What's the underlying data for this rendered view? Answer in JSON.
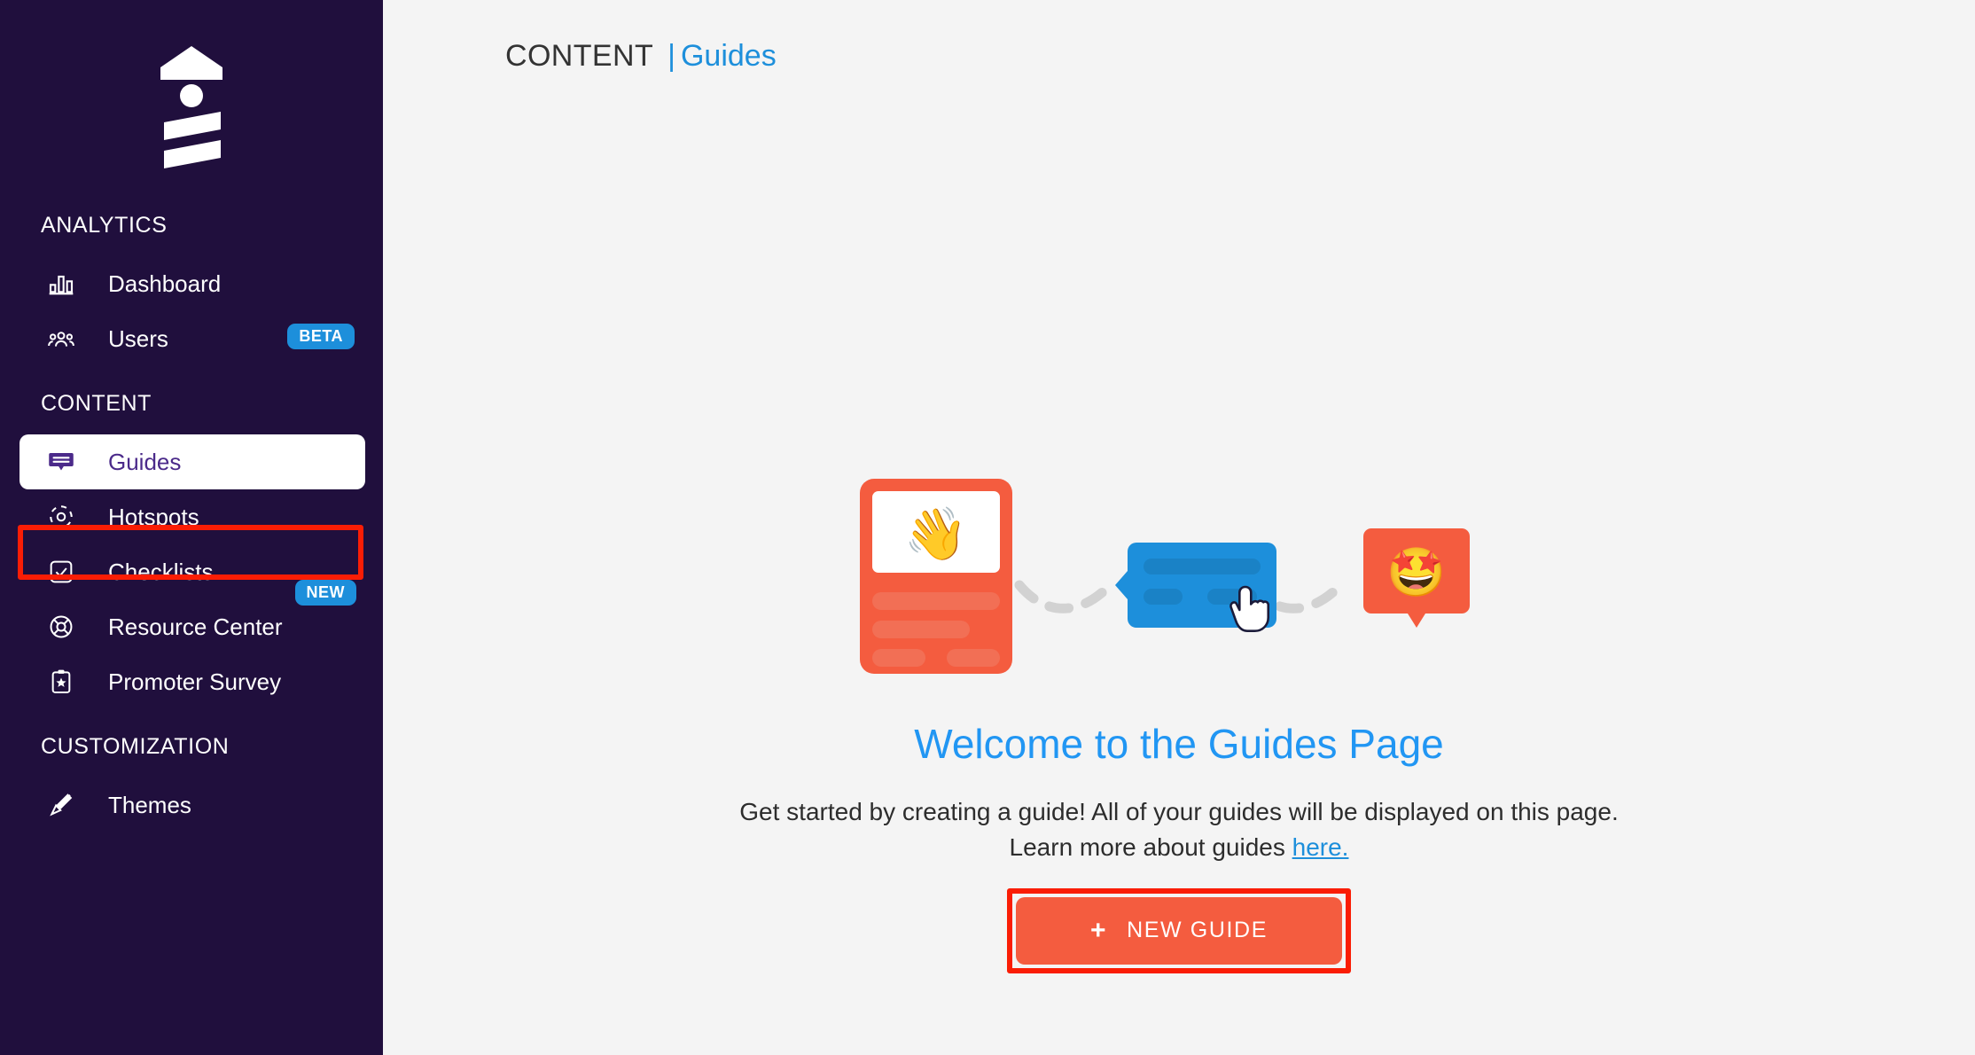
{
  "brand": {
    "logo_icon": "lighthouse-logo",
    "sidebar_bg": "#200f3d",
    "accent_blue": "#1d8fdb",
    "accent_orange": "#f45c3f",
    "highlight_red": "#fa1d05",
    "active_text_purple": "#4b2a8a"
  },
  "sidebar": {
    "groups": [
      {
        "title": "ANALYTICS",
        "items": [
          {
            "label": "Dashboard",
            "icon": "bar-chart-icon",
            "badge": null,
            "active": false
          },
          {
            "label": "Users",
            "icon": "users-icon",
            "badge": "BETA",
            "active": false
          }
        ]
      },
      {
        "title": "CONTENT",
        "items": [
          {
            "label": "Guides",
            "icon": "speech-bubble-icon",
            "badge": null,
            "active": true
          },
          {
            "label": "Hotspots",
            "icon": "hotspot-target-icon",
            "badge": null,
            "active": false
          },
          {
            "label": "Checklists",
            "icon": "checkbox-check-icon",
            "badge": null,
            "active": false
          },
          {
            "label": "Resource Center",
            "icon": "lifebuoy-icon",
            "badge": "NEW",
            "active": false
          },
          {
            "label": "Promoter Survey",
            "icon": "clipboard-star-icon",
            "badge": null,
            "active": false
          }
        ]
      },
      {
        "title": "CUSTOMIZATION",
        "items": [
          {
            "label": "Themes",
            "icon": "paintbrush-icon",
            "badge": null,
            "active": false
          }
        ]
      }
    ]
  },
  "header": {
    "breadcrumb_section": "CONTENT",
    "breadcrumb_separator": "|",
    "breadcrumb_current": "Guides"
  },
  "main": {
    "illustration": {
      "name": "guides-flow-illustration",
      "card1_emoji": "waving-hand-emoji",
      "card3_emoji": "star-struck-emoji",
      "cursor_icon": "pointing-hand-cursor"
    },
    "welcome_title": "Welcome to the Guides Page",
    "welcome_desc_part1": "Get started by creating a guide! All of your guides will be displayed on this page. Learn more about guides ",
    "welcome_desc_link": "here.",
    "new_guide_button": "NEW GUIDE",
    "new_guide_plus": "+"
  }
}
